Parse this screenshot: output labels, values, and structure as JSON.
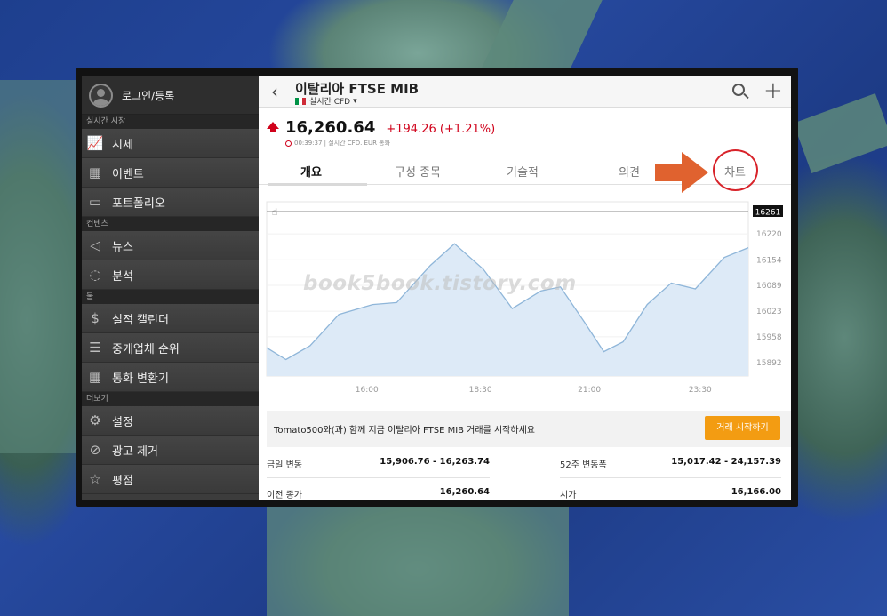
{
  "sidebar": {
    "login_label": "로그인/등록",
    "sections": [
      {
        "header": "실시간 시장",
        "items": [
          {
            "icon": "chart-line-icon",
            "glyph": "📈",
            "label": "시세"
          },
          {
            "icon": "calendar-icon",
            "glyph": "▦",
            "label": "이벤트"
          },
          {
            "icon": "briefcase-icon",
            "glyph": "▭",
            "label": "포트폴리오"
          }
        ]
      },
      {
        "header": "컨텐츠",
        "items": [
          {
            "icon": "megaphone-icon",
            "glyph": "◁",
            "label": "뉴스"
          },
          {
            "icon": "lightbulb-icon",
            "glyph": "◌",
            "label": "분석"
          }
        ]
      },
      {
        "header": "툴",
        "items": [
          {
            "icon": "dollar-coin-icon",
            "glyph": "$",
            "label": "실적 캘린더"
          },
          {
            "icon": "ranking-icon",
            "glyph": "☰",
            "label": "중개업체 순위"
          },
          {
            "icon": "calculator-icon",
            "glyph": "▦",
            "label": "통화 변환기"
          }
        ]
      },
      {
        "header": "더보기",
        "items": [
          {
            "icon": "gear-icon",
            "glyph": "⚙",
            "label": "설정"
          },
          {
            "icon": "ad-remove-icon",
            "glyph": "⊘",
            "label": "광고 제거"
          },
          {
            "icon": "star-icon",
            "glyph": "☆",
            "label": "평점"
          }
        ]
      }
    ]
  },
  "header": {
    "title": "이탈리아 FTSE MIB",
    "subtitle": "실시간 CFD",
    "flag_colors": [
      "#009246",
      "#ffffff",
      "#ce2b37"
    ]
  },
  "quote": {
    "price": "16,260.64",
    "change": "+194.26 (+1.21%)",
    "meta": "00:39:37 | 실시간 CFD. EUR 통화",
    "up_color": "#d0021b"
  },
  "tabs": [
    {
      "label": "개요",
      "active": true
    },
    {
      "label": "구성 종목",
      "active": false
    },
    {
      "label": "기술적",
      "active": false
    },
    {
      "label": "의견",
      "active": false
    },
    {
      "label": "차트",
      "active": false
    }
  ],
  "chart_data": {
    "type": "area",
    "y_ticks": [
      "16220",
      "16154",
      "16089",
      "16023",
      "15958",
      "15892"
    ],
    "x_ticks": [
      "16:00",
      "18:30",
      "21:00",
      "23:30"
    ],
    "last_value_label": "16261",
    "ylim": [
      15858,
      16277
    ],
    "x": [
      0,
      0.04,
      0.09,
      0.15,
      0.22,
      0.27,
      0.34,
      0.39,
      0.45,
      0.51,
      0.57,
      0.61,
      0.66,
      0.7,
      0.74,
      0.79,
      0.84,
      0.89,
      0.95,
      1.0
    ],
    "values": [
      15930,
      15900,
      15935,
      16015,
      16040,
      16045,
      16140,
      16195,
      16130,
      16030,
      16075,
      16085,
      15995,
      15920,
      15945,
      16040,
      16095,
      16080,
      16160,
      16185
    ],
    "line_color": "#8fb6d9",
    "fill_color": "#ddeaf7"
  },
  "watermark": "book5book.tistory.com",
  "banner": {
    "text": "Tomato500와(과) 함께 지금 이탈리아 FTSE MIB 거래를   시작하세요",
    "button": "거래 시작하기",
    "button_color": "#f39c12"
  },
  "stats": [
    {
      "label": "금일 변동",
      "value": "15,906.76 - 16,263.74"
    },
    {
      "label": "52주 변동폭",
      "value": "15,017.42 - 24,157.39"
    },
    {
      "label": "이전 종가",
      "value": "16,260.64"
    },
    {
      "label": "시가",
      "value": "16,166.00"
    }
  ]
}
